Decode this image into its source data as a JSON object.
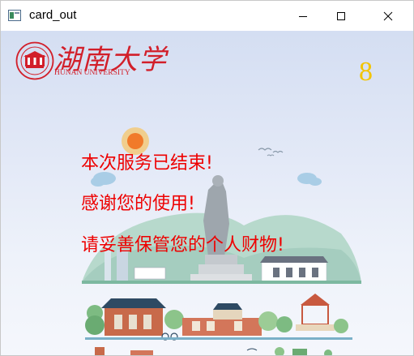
{
  "window": {
    "title": "card_out",
    "controls": [
      "minimize",
      "maximize",
      "close"
    ]
  },
  "logo": {
    "chinese": "湖南大学",
    "english": "HUNAN UNIVERSITY",
    "seal_text": "湖南大学"
  },
  "countdown": "8",
  "messages": [
    "本次服务已结束!",
    "感谢您的使用!",
    "请妥善保管您的个人财物!"
  ],
  "sign_text": "湖南大学",
  "colors": {
    "accent_red": "#d21f2a",
    "message_red": "#ee0000",
    "countdown_yellow": "#f2c400"
  }
}
